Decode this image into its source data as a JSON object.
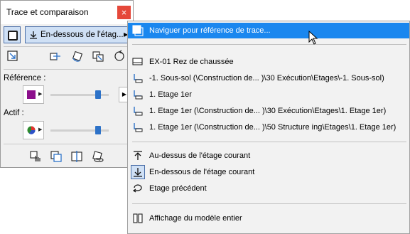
{
  "palette": {
    "title": "Trace et comparaison",
    "close_symbol": "×",
    "level_dropdown_label": "En-dessous de l'étag...",
    "reference_label": "Référence :",
    "active_label": "Actif :",
    "reference_swatch_color": "#8c0f8c",
    "reference_slider_level": 0.85,
    "active_slider_level": 0.85,
    "tool_icons": [
      "move-trace-icon",
      "move-icon",
      "rotate-icon",
      "mirror-icon",
      "reset-icon"
    ],
    "bottom_icons": [
      "hand-icon",
      "compare-icon",
      "split-icon",
      "ghost-icon"
    ]
  },
  "menu": {
    "items": [
      {
        "icon": "browse-reference-icon",
        "label": "Naviguer pour référence de trace...",
        "highlighted": true
      },
      {
        "icon": "story-icon",
        "label": "EX-01 Rez de chaussée"
      },
      {
        "icon": "linked-story-icon",
        "label": "-1. Sous-sol (\\Construction de... )\\30 Exécution\\Etages\\-1. Sous-sol)"
      },
      {
        "icon": "linked-story-icon",
        "label": "1. Etage 1er"
      },
      {
        "icon": "linked-story-icon",
        "label": "1. Etage 1er (\\Construction de... )\\30 Exécution\\Etages\\1. Etage 1er)"
      },
      {
        "icon": "linked-story-icon",
        "label": "1. Etage 1er (\\Construction de... )\\50 Structure ing\\Etages\\1. Etage 1er)"
      },
      {
        "icon": "arrow-up-icon",
        "label": "Au-dessus de l'étage courant"
      },
      {
        "icon": "arrow-down-icon",
        "label": "En-dessous de l'étage courant"
      },
      {
        "icon": "previous-story-icon",
        "label": "Etage précédent"
      },
      {
        "icon": "model-view-icon",
        "label": "Affichage du modèle entier"
      }
    ]
  },
  "colors": {
    "highlight": "#1a87ef",
    "close_button": "#e5483a",
    "selected_button": "#cfe0f5",
    "slider_thumb": "#2d72c8"
  }
}
